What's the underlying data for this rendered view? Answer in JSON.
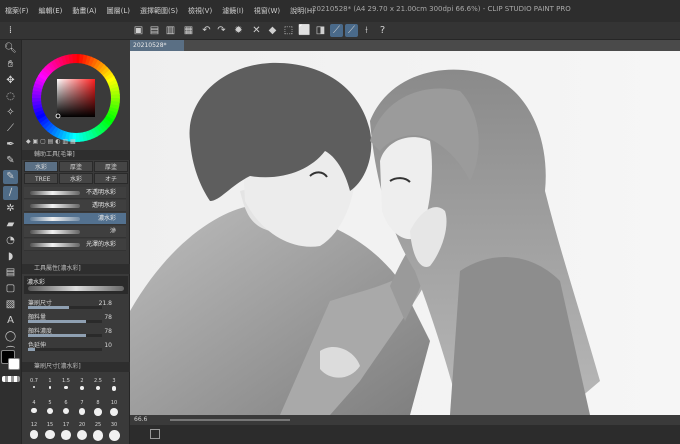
{
  "window": {
    "title": "20210528* (A4 29.70 x 21.00cm 300dpi 66.6%) - CLIP STUDIO PAINT PRO"
  },
  "menu": [
    {
      "label": "檔案(F)"
    },
    {
      "label": "編輯(E)"
    },
    {
      "label": "動畫(A)"
    },
    {
      "label": "圖層(L)"
    },
    {
      "label": "選擇範圍(S)"
    },
    {
      "label": "檢視(V)"
    },
    {
      "label": "濾鏡(I)"
    },
    {
      "label": "視窗(W)"
    },
    {
      "label": "說明(H)"
    }
  ],
  "canvas": {
    "doc_tab": "20210528*",
    "zoom": "66.6"
  },
  "color": {
    "accent": "#5a6f84",
    "main_color": "#000000",
    "sub_color": "#ffffff"
  },
  "subtool": {
    "header": "輔助工具[毛筆]",
    "tabs": [
      {
        "label": "水彩"
      },
      {
        "label": "厚塗"
      },
      {
        "label": "厚塗"
      },
      {
        "label": "TREE"
      },
      {
        "label": "水彩"
      },
      {
        "label": "オチ"
      }
    ],
    "brushes": [
      {
        "name": "不透明水彩"
      },
      {
        "name": "透明水彩"
      },
      {
        "name": "濃水彩"
      },
      {
        "name": "滲"
      },
      {
        "name": "光澤的水彩"
      }
    ]
  },
  "tool_property": {
    "header": "工具屬性[濃水彩]",
    "brush_name": "濃水彩",
    "properties": [
      {
        "label": "筆刷尺寸",
        "value": "21.8",
        "fraction": 0.55
      },
      {
        "label": "顏料量",
        "value": "78",
        "fraction": 0.78
      },
      {
        "label": "顏料濃度",
        "value": "78",
        "fraction": 0.78
      },
      {
        "label": "色延伸",
        "value": "10",
        "fraction": 0.1
      }
    ]
  },
  "brush_size": {
    "header": "筆刷尺寸[濃水彩]",
    "sizes": [
      "0.7",
      "1",
      "1.5",
      "2",
      "2.5",
      "3",
      "4",
      "5",
      "6",
      "7",
      "8",
      "10",
      "12",
      "15",
      "17",
      "20",
      "25",
      "30"
    ]
  }
}
